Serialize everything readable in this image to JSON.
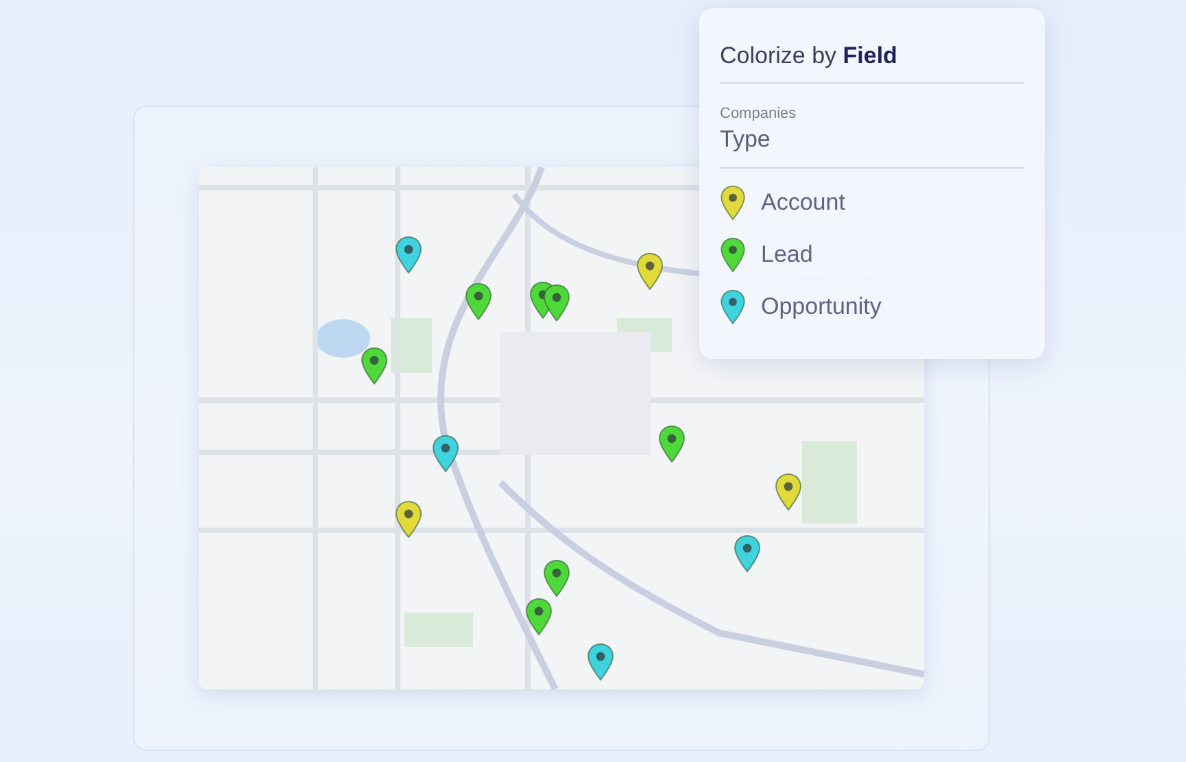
{
  "map": {
    "kind": "picture",
    "pins": [
      {
        "color": "#3fd3e0"
      },
      {
        "color": "#4fd83a"
      },
      {
        "color": "#4fd83a"
      },
      {
        "color": "#4fd83a"
      },
      {
        "color": "#e2d93a"
      },
      {
        "color": "#4fd83a"
      },
      {
        "color": "#3fd3e0"
      },
      {
        "color": "#4fd83a"
      },
      {
        "color": "#e2d93a"
      },
      {
        "color": "#e2d93a"
      },
      {
        "color": "#3fd3e0"
      },
      {
        "color": "#4fd83a"
      },
      {
        "color": "#4fd83a"
      },
      {
        "color": "#3fd3e0"
      }
    ]
  },
  "panel": {
    "title": "Colorize by **Field**",
    "object": "Companies",
    "field": "Type",
    "legend": [
      {
        "label": "Account",
        "color": "#e2d93a"
      },
      {
        "label": "Lead",
        "color": "#4fd83a"
      },
      {
        "label": "Opportunity",
        "color": "#3fd3e0"
      }
    ]
  }
}
